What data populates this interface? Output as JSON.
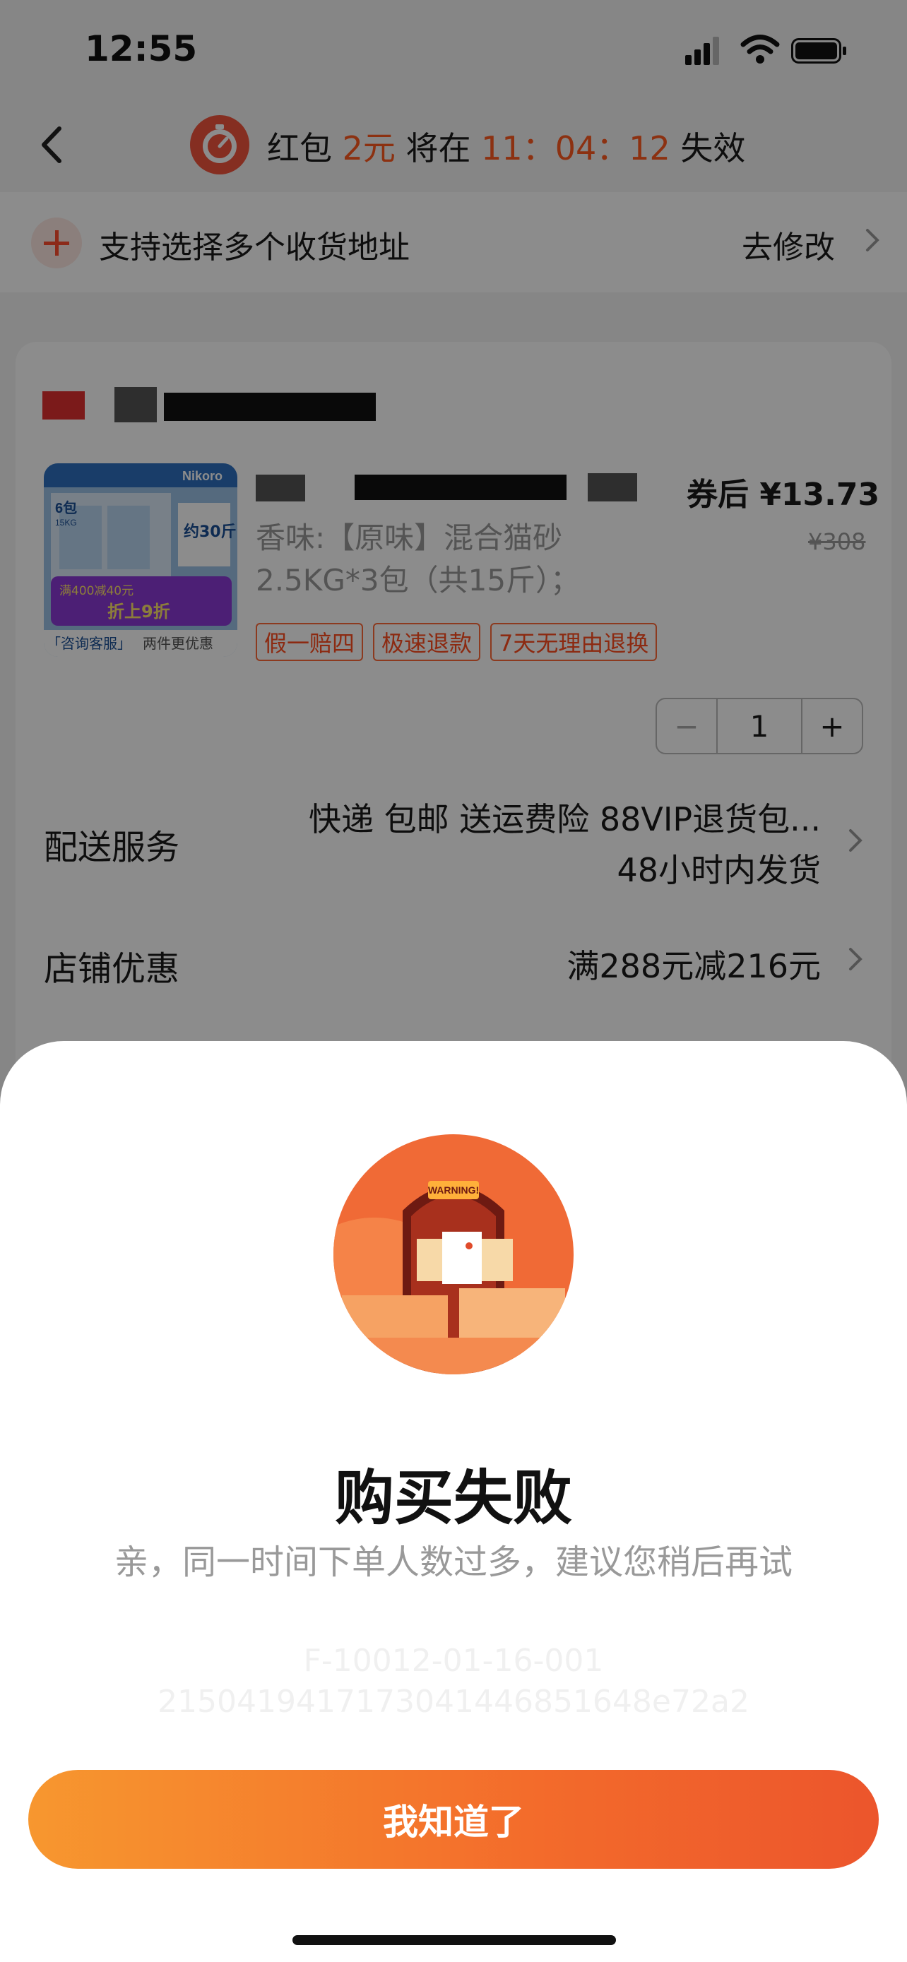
{
  "status_bar": {
    "time": "12:55"
  },
  "header": {
    "prefix": "红包",
    "amount": "2元",
    "mid": "将在",
    "countdown": "11：04：12",
    "suffix": "失效"
  },
  "address_bar": {
    "text": "支持选择多个收货地址",
    "action": "去修改"
  },
  "item": {
    "price": "券后 ¥13.73",
    "original_price": "¥308",
    "variant_line1": "香味:【原味】混合猫砂",
    "variant_line2": "2.5KG*3包（共15斤）；",
    "tags": [
      "假一赔四",
      "极速退款",
      "7天无理由退换"
    ],
    "quantity": "1",
    "image": {
      "brand": "Nikoro",
      "packs": "6包",
      "weight": "15KG",
      "about": "约30斤",
      "promo": "满400减40元",
      "discount": "折上9折",
      "footer_left": "「咨询客服」",
      "footer_right": "两件更优惠"
    }
  },
  "delivery": {
    "label": "配送服务",
    "line1": "快递 包邮 送运费险 88VIP退货包...",
    "line2": "48小时内发货"
  },
  "discount": {
    "label": "店铺优惠",
    "value": "满288元减216元"
  },
  "modal": {
    "illustration_text": "WARNING!",
    "title": "购买失败",
    "message": "亲，同一时间下单人数过多，建议您稍后再试",
    "error_code": "F-10012-01-16-001",
    "trace_id": "2150419417173041446851648e72a2",
    "button": "我知道了"
  },
  "colors": {
    "accent": "#ff5a1f",
    "button_start": "#f7972f",
    "button_end": "#ec552c"
  }
}
